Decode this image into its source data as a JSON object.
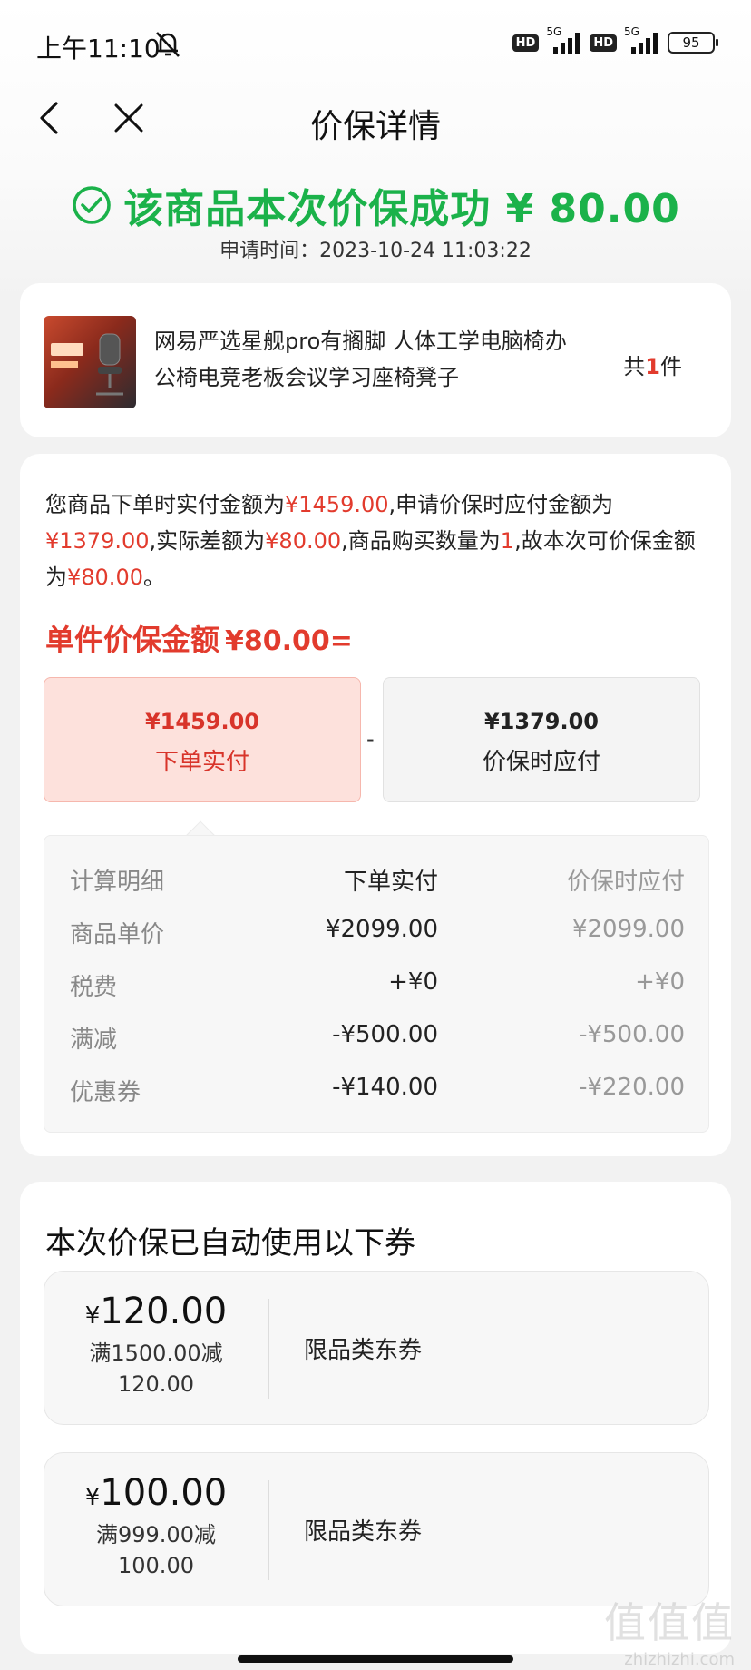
{
  "status_bar": {
    "time": "上午11:10",
    "hd1": "HD",
    "net1": "5G",
    "hd2": "HD",
    "net2": "5G",
    "battery": "95"
  },
  "nav": {
    "title": "价保详情",
    "back_icon": "back-chevron-icon",
    "close_icon": "close-icon"
  },
  "header": {
    "success_text": "该商品本次价保成功 ¥ 80.00",
    "apply_time": "申请时间：2023-10-24 11:03:22",
    "success_color": "#1bb24a"
  },
  "product": {
    "name": "网易严选星舰pro有搁脚 人体工学电脑椅办公椅电竞老板会议学习座椅凳子",
    "qty_prefix": "共",
    "qty_num": "1",
    "qty_suffix": "件"
  },
  "detail": {
    "desc": {
      "p1": "您商品下单时实付金额为",
      "v1": "¥1459.00",
      "p2": ",申请价保时应付金额为",
      "v2": "¥1379.00",
      "p3": ",实际差额为",
      "v3": "¥80.00",
      "p4": ",商品购买数量为",
      "v4": "1",
      "p5": ",故本次可价保金额为",
      "v5": "¥80.00",
      "p6": "。"
    },
    "unit_label": "单件价保金额",
    "unit_amount": "¥80.00=",
    "box_left": {
      "amount": "¥1459.00",
      "label": "下单实付"
    },
    "minus": "-",
    "box_right": {
      "amount": "¥1379.00",
      "label": "价保时应付"
    },
    "calc": {
      "headers": [
        "计算明细",
        "下单实付",
        "价保时应付"
      ],
      "rows": [
        [
          "商品单价",
          "¥2099.00",
          "¥2099.00"
        ],
        [
          "税费",
          "+¥0",
          "+¥0"
        ],
        [
          "满减",
          "-¥500.00",
          "-¥500.00"
        ],
        [
          "优惠券",
          "-¥140.00",
          "-¥220.00"
        ]
      ]
    },
    "accent_red": "#e23b2d"
  },
  "coupons": {
    "title": "本次价保已自动使用以下券",
    "items": [
      {
        "symbol": "¥",
        "amount": "120.00",
        "rule": "满1500.00减120.00",
        "scope": "限品类东券"
      },
      {
        "symbol": "¥",
        "amount": "100.00",
        "rule": "满999.00减100.00",
        "scope": "限品类东券"
      }
    ]
  },
  "watermark": {
    "logo": "值值值",
    "url": "zhizhizhi.com"
  }
}
